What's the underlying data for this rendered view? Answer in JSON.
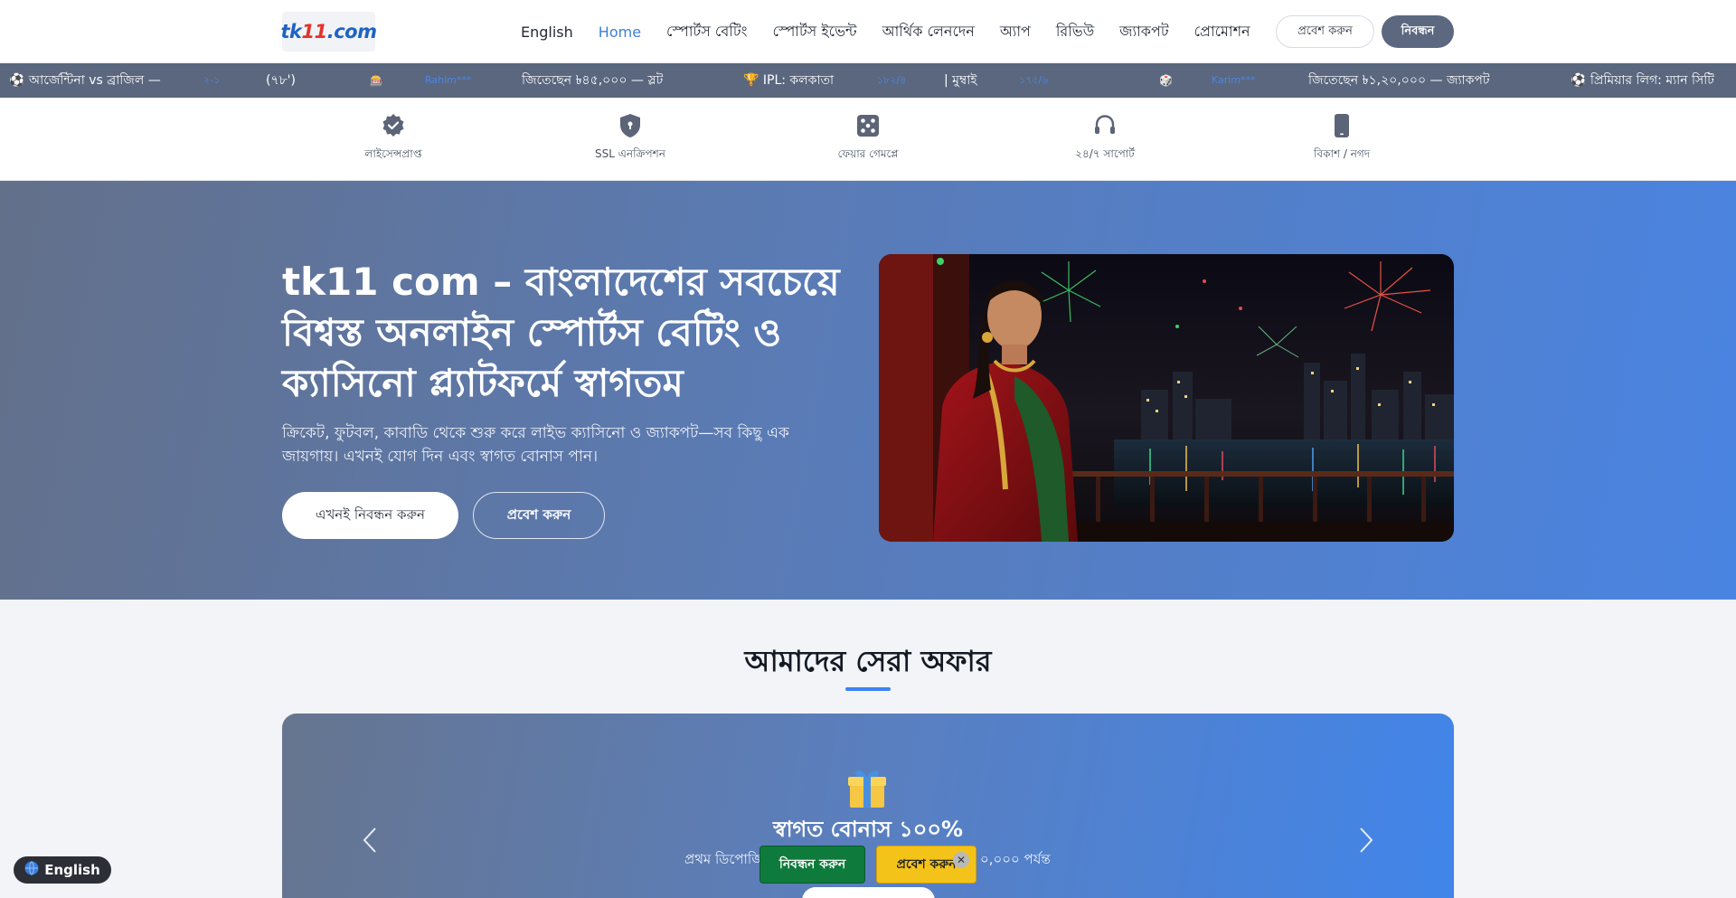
{
  "header": {
    "logo_text": "tk11.com",
    "logo_prefix": "tk",
    "logo_digits": "11",
    "logo_suffix": ".com",
    "nav": [
      {
        "label": "English",
        "active": false
      },
      {
        "label": "Home",
        "active": true
      },
      {
        "label": "স্পোর্টস বেটিং",
        "active": false
      },
      {
        "label": "স্পোর্টস ইভেন্ট",
        "active": false
      },
      {
        "label": "আর্থিক লেনদেন",
        "active": false
      },
      {
        "label": "অ্যাপ",
        "active": false
      },
      {
        "label": "রিভিউ",
        "active": false
      },
      {
        "label": "জ্যাকপট",
        "active": false
      },
      {
        "label": "প্রোমোশন",
        "active": false
      }
    ],
    "login_label": "প্রবেশ করুন",
    "register_label": "নিবন্ধন"
  },
  "ticker": {
    "items": [
      "⚽ আর্জেন্টিনা vs ব্রাজিল —",
      "২-১",
      "(৭৮')",
      "🎰",
      "Rahim***",
      "জিতেছেন ৳৪৫,০০০ — স্লট",
      "🏆 IPL: কলকাতা",
      "১৮২/৪",
      "| মুম্বাই",
      "১৭৫/৬",
      "🎲",
      "Karim***",
      "জিতেছেন ৳১,২০,০০০ — জ্যাকপট",
      "⚽ প্রিমিয়ার লিগ: ম্যান সিটি"
    ]
  },
  "trust": {
    "items": [
      {
        "label": "লাইসেন্সপ্রাপ্ত",
        "icon": "verified-badge-icon"
      },
      {
        "label": "SSL এনক্রিপশন",
        "icon": "shield-lock-icon"
      },
      {
        "label": "ফেয়ার গেমপ্লে",
        "icon": "dice-icon"
      },
      {
        "label": "২৪/৭ সাপোর্ট",
        "icon": "headset-icon"
      },
      {
        "label": "বিকাশ / নগদ",
        "icon": "mobile-phone-icon"
      }
    ]
  },
  "hero": {
    "title": "tk11 com – বাংলাদেশের সবচেয়ে বিশ্বস্ত অনলাইন স্পোর্টস বেটিং ও ক্যাসিনো প্ল্যাটফর্মে স্বাগতম",
    "subtitle": "ক্রিকেট, ফুটবল, কাবাডি থেকে শুরু করে লাইভ ক্যাসিনো ও জ্যাকপট—সব কিছু এক জায়গায়। এখনই যোগ দিন এবং স্বাগত বোনাস পান।",
    "primary_button": "এখনই নিবন্ধন করুন",
    "secondary_button": "প্রবেশ করুন"
  },
  "offers": {
    "title": "আমাদের সেরা অফার",
    "card_title": "স্বাগত বোনাস ১০০%",
    "card_sub_left": "প্রথম ডিপোজি",
    "card_sub_right": "০,০০০ পর্যন্ত"
  },
  "floating": {
    "register": "নিবন্ধন করুন",
    "login": "প্রবেশ করুন",
    "close": "✕"
  },
  "language_switch": {
    "label": "English",
    "icon": "globe-icon"
  },
  "colors": {
    "accent": "#3d7fd6",
    "ticker_bg": "#5a677f",
    "register_green": "#0e7a3b",
    "login_yellow": "#f4c319"
  }
}
